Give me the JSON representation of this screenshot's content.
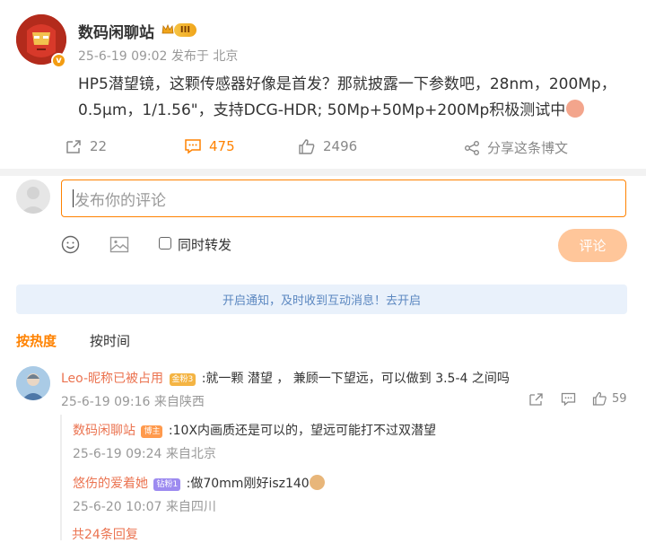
{
  "post": {
    "author": "数码闲聊站",
    "level_badge": "III",
    "date": "25-6-19 09:02",
    "location": "发布于 北京",
    "content": "HP5潜望镜，这颗传感器好像是首发？那就披露一下参数吧，28nm，200Mp，0.5μm，1/1.56\"，支持DCG-HDR; 50Mp+50Mp+200Mp积极测试中",
    "repost_count": "22",
    "comment_count": "475",
    "like_count": "2496",
    "share_label": "分享这条博文",
    "verified_icon": "v-badge"
  },
  "composer": {
    "placeholder": "发布你的评论",
    "repost_label": "同时转发",
    "submit_label": "评论"
  },
  "notice": "开启通知，及时收到互动消息！去开启",
  "sort": {
    "hot": "按热度",
    "time": "按时间"
  },
  "comments": [
    {
      "name": "Leo-昵称已被占用",
      "badge": "金粉3",
      "text": ":就一颗 潜望 ， 兼顾一下望远，可以做到 3.5-4 之间吗",
      "date": "25-6-19 09:16",
      "location": "来自陕西",
      "likes": "59",
      "replies": [
        {
          "name": "数码闲聊站",
          "badge": "博主",
          "text": ":10X内画质还是可以的，望远可能打不过双潜望",
          "date": "25-6-19 09:24",
          "location": "来自北京"
        },
        {
          "name": "悠伤的爱着她",
          "badge": "钻粉1",
          "text": ":做70mm刚好isz140",
          "date": "25-6-20 10:07",
          "location": "来自四川"
        }
      ],
      "more_label": "共24条回复"
    }
  ],
  "colors": {
    "accent": "#ff8200",
    "name": "#eb7350",
    "notice_bg": "#e9f1fb"
  }
}
